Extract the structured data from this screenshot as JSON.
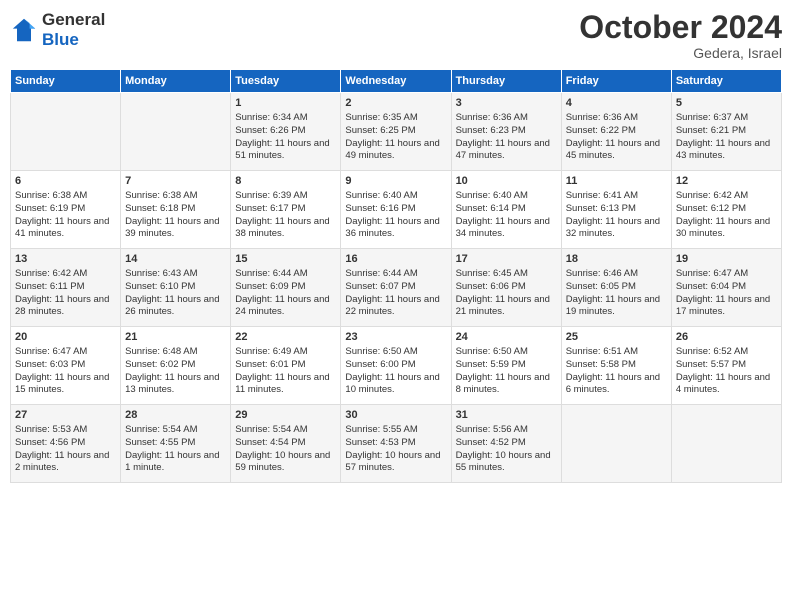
{
  "header": {
    "logo_general": "General",
    "logo_blue": "Blue",
    "month": "October 2024",
    "location": "Gedera, Israel"
  },
  "days_of_week": [
    "Sunday",
    "Monday",
    "Tuesday",
    "Wednesday",
    "Thursday",
    "Friday",
    "Saturday"
  ],
  "weeks": [
    [
      {
        "day": "",
        "info": ""
      },
      {
        "day": "",
        "info": ""
      },
      {
        "day": "1",
        "info": "Sunrise: 6:34 AM\nSunset: 6:26 PM\nDaylight: 11 hours and 51 minutes."
      },
      {
        "day": "2",
        "info": "Sunrise: 6:35 AM\nSunset: 6:25 PM\nDaylight: 11 hours and 49 minutes."
      },
      {
        "day": "3",
        "info": "Sunrise: 6:36 AM\nSunset: 6:23 PM\nDaylight: 11 hours and 47 minutes."
      },
      {
        "day": "4",
        "info": "Sunrise: 6:36 AM\nSunset: 6:22 PM\nDaylight: 11 hours and 45 minutes."
      },
      {
        "day": "5",
        "info": "Sunrise: 6:37 AM\nSunset: 6:21 PM\nDaylight: 11 hours and 43 minutes."
      }
    ],
    [
      {
        "day": "6",
        "info": "Sunrise: 6:38 AM\nSunset: 6:19 PM\nDaylight: 11 hours and 41 minutes."
      },
      {
        "day": "7",
        "info": "Sunrise: 6:38 AM\nSunset: 6:18 PM\nDaylight: 11 hours and 39 minutes."
      },
      {
        "day": "8",
        "info": "Sunrise: 6:39 AM\nSunset: 6:17 PM\nDaylight: 11 hours and 38 minutes."
      },
      {
        "day": "9",
        "info": "Sunrise: 6:40 AM\nSunset: 6:16 PM\nDaylight: 11 hours and 36 minutes."
      },
      {
        "day": "10",
        "info": "Sunrise: 6:40 AM\nSunset: 6:14 PM\nDaylight: 11 hours and 34 minutes."
      },
      {
        "day": "11",
        "info": "Sunrise: 6:41 AM\nSunset: 6:13 PM\nDaylight: 11 hours and 32 minutes."
      },
      {
        "day": "12",
        "info": "Sunrise: 6:42 AM\nSunset: 6:12 PM\nDaylight: 11 hours and 30 minutes."
      }
    ],
    [
      {
        "day": "13",
        "info": "Sunrise: 6:42 AM\nSunset: 6:11 PM\nDaylight: 11 hours and 28 minutes."
      },
      {
        "day": "14",
        "info": "Sunrise: 6:43 AM\nSunset: 6:10 PM\nDaylight: 11 hours and 26 minutes."
      },
      {
        "day": "15",
        "info": "Sunrise: 6:44 AM\nSunset: 6:09 PM\nDaylight: 11 hours and 24 minutes."
      },
      {
        "day": "16",
        "info": "Sunrise: 6:44 AM\nSunset: 6:07 PM\nDaylight: 11 hours and 22 minutes."
      },
      {
        "day": "17",
        "info": "Sunrise: 6:45 AM\nSunset: 6:06 PM\nDaylight: 11 hours and 21 minutes."
      },
      {
        "day": "18",
        "info": "Sunrise: 6:46 AM\nSunset: 6:05 PM\nDaylight: 11 hours and 19 minutes."
      },
      {
        "day": "19",
        "info": "Sunrise: 6:47 AM\nSunset: 6:04 PM\nDaylight: 11 hours and 17 minutes."
      }
    ],
    [
      {
        "day": "20",
        "info": "Sunrise: 6:47 AM\nSunset: 6:03 PM\nDaylight: 11 hours and 15 minutes."
      },
      {
        "day": "21",
        "info": "Sunrise: 6:48 AM\nSunset: 6:02 PM\nDaylight: 11 hours and 13 minutes."
      },
      {
        "day": "22",
        "info": "Sunrise: 6:49 AM\nSunset: 6:01 PM\nDaylight: 11 hours and 11 minutes."
      },
      {
        "day": "23",
        "info": "Sunrise: 6:50 AM\nSunset: 6:00 PM\nDaylight: 11 hours and 10 minutes."
      },
      {
        "day": "24",
        "info": "Sunrise: 6:50 AM\nSunset: 5:59 PM\nDaylight: 11 hours and 8 minutes."
      },
      {
        "day": "25",
        "info": "Sunrise: 6:51 AM\nSunset: 5:58 PM\nDaylight: 11 hours and 6 minutes."
      },
      {
        "day": "26",
        "info": "Sunrise: 6:52 AM\nSunset: 5:57 PM\nDaylight: 11 hours and 4 minutes."
      }
    ],
    [
      {
        "day": "27",
        "info": "Sunrise: 5:53 AM\nSunset: 4:56 PM\nDaylight: 11 hours and 2 minutes."
      },
      {
        "day": "28",
        "info": "Sunrise: 5:54 AM\nSunset: 4:55 PM\nDaylight: 11 hours and 1 minute."
      },
      {
        "day": "29",
        "info": "Sunrise: 5:54 AM\nSunset: 4:54 PM\nDaylight: 10 hours and 59 minutes."
      },
      {
        "day": "30",
        "info": "Sunrise: 5:55 AM\nSunset: 4:53 PM\nDaylight: 10 hours and 57 minutes."
      },
      {
        "day": "31",
        "info": "Sunrise: 5:56 AM\nSunset: 4:52 PM\nDaylight: 10 hours and 55 minutes."
      },
      {
        "day": "",
        "info": ""
      },
      {
        "day": "",
        "info": ""
      }
    ]
  ]
}
